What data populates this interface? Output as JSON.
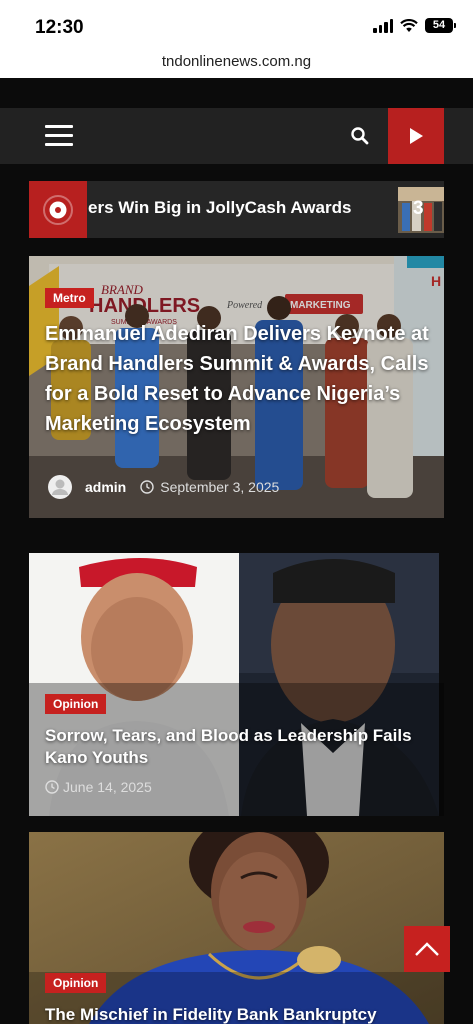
{
  "status_bar": {
    "time": "12:30",
    "battery": "54"
  },
  "browser": {
    "url": "tndonlinenews.com.ng"
  },
  "ticker": {
    "text": "ers Win Big in JollyCash Awards",
    "number": "3"
  },
  "articles": [
    {
      "category": "Metro",
      "title": "Emmanuel Adediran Delivers Keynote at Brand Handlers Summit & Awards, Calls for a Bold Reset to Advance Nigeria’s Marketing Ecosystem",
      "author": "admin",
      "date": "September 3, 2025",
      "banner_text": {
        "brand": "BRAND",
        "handlers": "HANDLERS",
        "summit": "SUMMIT & AWARDS",
        "powered": "Powered",
        "marketing": "MARKETING",
        "edge": "H"
      }
    },
    {
      "category": "Opinion",
      "title": "Sorrow, Tears, and Blood as Leadership Fails Kano Youths",
      "date": "June 14, 2025"
    },
    {
      "category": "Opinion",
      "title": "The Mischief in Fidelity Bank Bankruptcy"
    }
  ],
  "colors": {
    "accent": "#c6211f",
    "header_bg": "#222222",
    "page_bg": "#0b0b0b"
  },
  "icons": [
    "menu-icon",
    "search-icon",
    "play-icon",
    "live-radio-icon",
    "user-avatar-icon",
    "clock-icon",
    "arrow-up-icon"
  ]
}
